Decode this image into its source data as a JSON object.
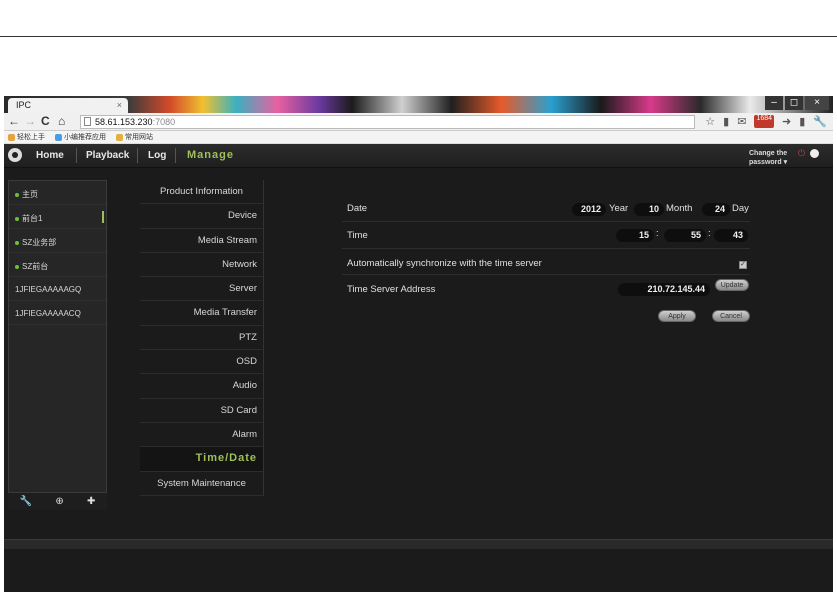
{
  "browser": {
    "tab_title": "IPC",
    "tab_close": "×",
    "window_controls": [
      "–",
      "◻",
      "×"
    ],
    "nav": {
      "back": "←",
      "forward": "→",
      "reload": "C",
      "home": "⌂"
    },
    "url_host": "58.61.153.230",
    "url_port": ":7080",
    "toolbar_badge": "1684",
    "bookmarks": [
      "轻松上手",
      "小编推荐应用",
      "常用网站"
    ]
  },
  "app": {
    "menu": [
      "Home",
      "Playback",
      "Log",
      "Manage"
    ],
    "change_password": "Change the password ▾"
  },
  "devices": [
    {
      "label": "主页",
      "dot": true
    },
    {
      "label": "前台1",
      "dot": true
    },
    {
      "label": "SZ业务部",
      "dot": true
    },
    {
      "label": "SZ前台",
      "dot": true
    },
    {
      "label": "1JFIEGAAAAAGQ",
      "dot": false
    },
    {
      "label": "1JFIEGAAAAACQ",
      "dot": false
    }
  ],
  "left_footer_icons": [
    "wrench-icon",
    "zoom-icon",
    "plus-icon"
  ],
  "settings_menu": [
    "Product Information",
    "Device",
    "Media Stream",
    "Network",
    "Server",
    "Media Transfer",
    "PTZ",
    "OSD",
    "Audio",
    "SD Card",
    "Alarm",
    "Time/Date",
    "System Maintenance"
  ],
  "form": {
    "date_label": "Date",
    "year": "2012",
    "year_unit": "Year",
    "month": "10",
    "month_unit": "Month",
    "day": "24",
    "day_unit": "Day",
    "time_label": "Time",
    "hour": "15",
    "minute": "55",
    "second": "43",
    "time_sep": ":",
    "auto_sync_label": "Automatically synchronize with the time server",
    "auto_sync_checked": true,
    "server_label": "Time Server Address",
    "server_address": "210.72.145.44",
    "update_btn": "Update",
    "apply_btn": "Apply",
    "cancel_btn": "Cancel"
  },
  "colors": {
    "accent": "#9fbf5a",
    "panel": "#262626",
    "background": "#1b1b1b"
  }
}
